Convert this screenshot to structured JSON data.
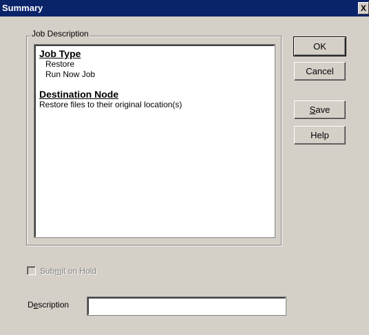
{
  "window": {
    "title": "Summary",
    "close_glyph": "X"
  },
  "group": {
    "legend": "Job Description",
    "sections": [
      {
        "heading": "Job Type",
        "items": [
          "Restore",
          "Run Now Job"
        ]
      },
      {
        "heading": "Destination Node",
        "items": [
          "Restore files to their original location(s)"
        ]
      }
    ]
  },
  "buttons": {
    "ok": "OK",
    "cancel": "Cancel",
    "save_pre": "",
    "save_mn": "S",
    "save_post": "ave",
    "help": "Help"
  },
  "checkbox": {
    "label_pre": "Sub",
    "label_mn": "m",
    "label_post": "it on Hold",
    "checked": false,
    "enabled": false
  },
  "description": {
    "label_pre": "D",
    "label_mn": "e",
    "label_post": "scription",
    "value": ""
  }
}
